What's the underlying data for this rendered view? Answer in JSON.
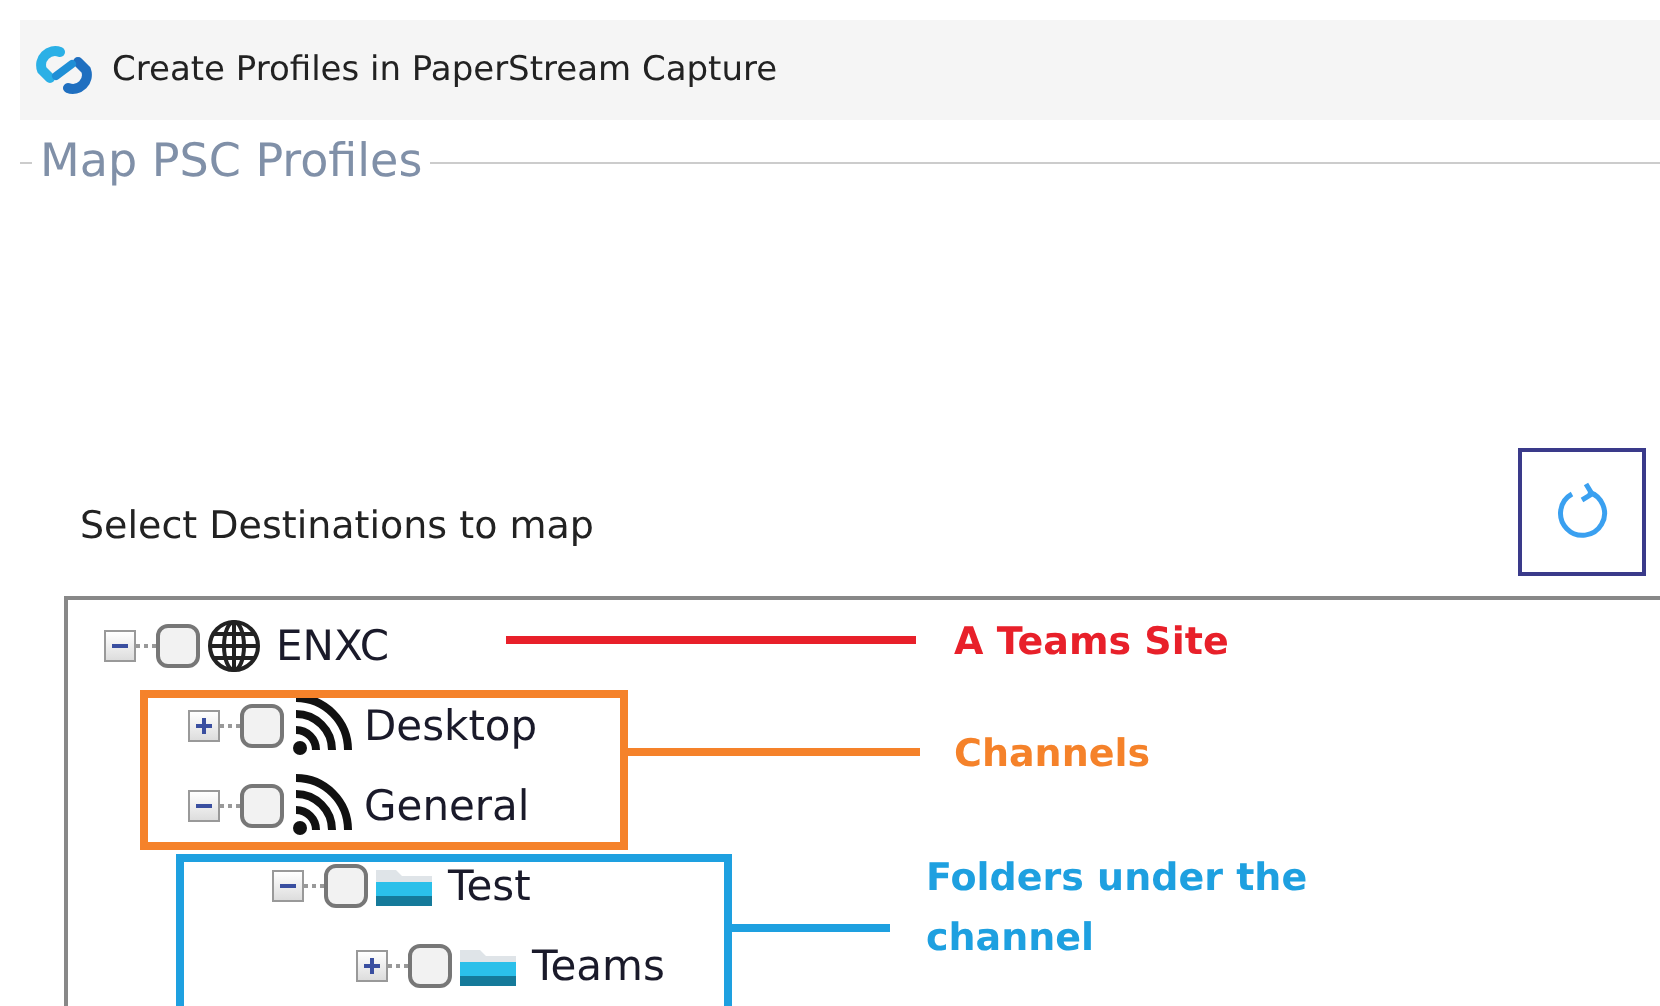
{
  "window": {
    "title": "Create Profiles in PaperStream Capture"
  },
  "group": {
    "title": "Map PSC Profiles"
  },
  "destinations": {
    "label": "Select Destinations to map"
  },
  "tree": [
    {
      "label": "ENXC",
      "kind": "site",
      "checked": false,
      "expanded": true,
      "children": [
        {
          "label": "Desktop",
          "kind": "channel",
          "checked": false,
          "expanded": false
        },
        {
          "label": "General",
          "kind": "channel",
          "checked": false,
          "expanded": true,
          "children": [
            {
              "label": "Test",
              "kind": "folder",
              "checked": false,
              "expanded": true,
              "children": [
                {
                  "label": "Teams",
                  "kind": "folder",
                  "checked": false,
                  "expanded": false
                }
              ]
            }
          ]
        }
      ]
    }
  ],
  "annotations": [
    {
      "kind": "line",
      "label": "A Teams Site",
      "color": "#e8202a"
    },
    {
      "kind": "box",
      "label": "Channels",
      "color": "#f5822a"
    },
    {
      "kind": "box",
      "label": "Folders under the channel",
      "color": "#1ea0e0"
    }
  ]
}
